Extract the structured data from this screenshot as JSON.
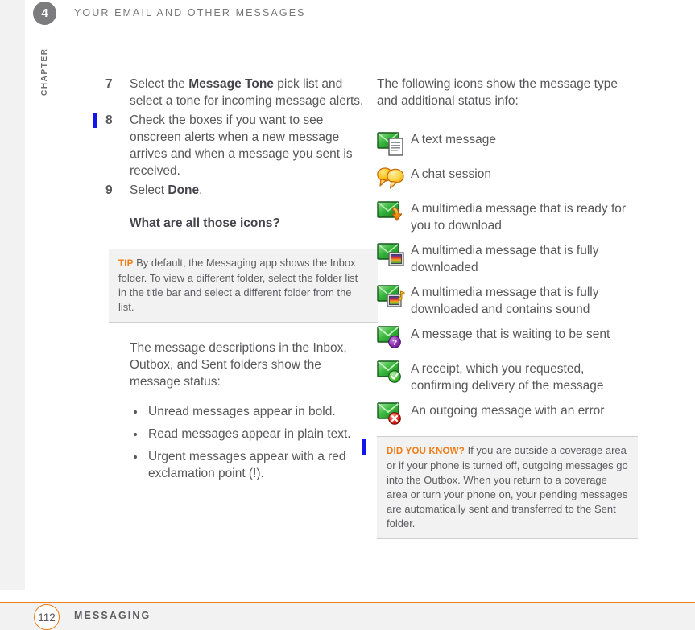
{
  "header": {
    "chapter_number": "4",
    "chapter_word": "CHAPTER",
    "running_head": "YOUR EMAIL AND OTHER MESSAGES"
  },
  "footer": {
    "page_number": "112",
    "section_title": "MESSAGING"
  },
  "left_column": {
    "steps": [
      {
        "number": "7",
        "text_before": "Select the ",
        "bold": "Message Tone",
        "text_after": " pick list and select a tone for incoming message alerts."
      },
      {
        "number": "8",
        "text_before": "Check the boxes if you want to see onscreen alerts when a new message arrives and when a message you sent is received.",
        "bold": "",
        "text_after": ""
      },
      {
        "number": "9",
        "text_before": "Select ",
        "bold": "Done",
        "text_after": "."
      }
    ],
    "subheading": "What are all those icons?",
    "tip": {
      "tag": "TIP",
      "text": "By default, the Messaging app shows the Inbox folder. To view a different folder, select the folder list in the title bar and select a different folder from the list."
    },
    "status_intro": "The message descriptions in the Inbox, Outbox, and Sent folders show the message status:",
    "bullets": [
      "Unread messages appear in bold.",
      "Read messages appear in plain text.",
      "Urgent messages appear with a red exclamation point (!)."
    ]
  },
  "right_column": {
    "intro": "The following icons show the message type and additional status info:",
    "icons": [
      {
        "icon": "envelope-document-icon",
        "label": "A text message"
      },
      {
        "icon": "chat-bubbles-icon",
        "label": "A chat session"
      },
      {
        "icon": "envelope-download-arrow-icon",
        "label": "A multimedia message that is ready for you to download"
      },
      {
        "icon": "envelope-picture-icon",
        "label": "A multimedia message that is fully downloaded"
      },
      {
        "icon": "envelope-picture-sound-icon",
        "label": "A multimedia message that is fully downloaded and contains sound"
      },
      {
        "icon": "envelope-pending-question-icon",
        "label": "A message that is waiting to be sent"
      },
      {
        "icon": "envelope-check-icon",
        "label": "A receipt, which you requested, confirming delivery of the message"
      },
      {
        "icon": "envelope-error-icon",
        "label": "An outgoing message with an error"
      }
    ],
    "did_you_know": {
      "tag": "DID YOU KNOW?",
      "text": "If you are outside a coverage area or if your phone is turned off, outgoing messages go into the Outbox. When you return to a coverage area or turn your phone on, your pending messages are automatically sent and transferred to the Sent folder."
    }
  },
  "colors": {
    "accent_orange": "#ef7d1a",
    "tag_orange": "#f07d17",
    "change_bar_blue": "#1414ee",
    "chapter_gray": "#7c7c7e",
    "callout_bg": "#f2f2f2",
    "body_text": "#58585a"
  }
}
